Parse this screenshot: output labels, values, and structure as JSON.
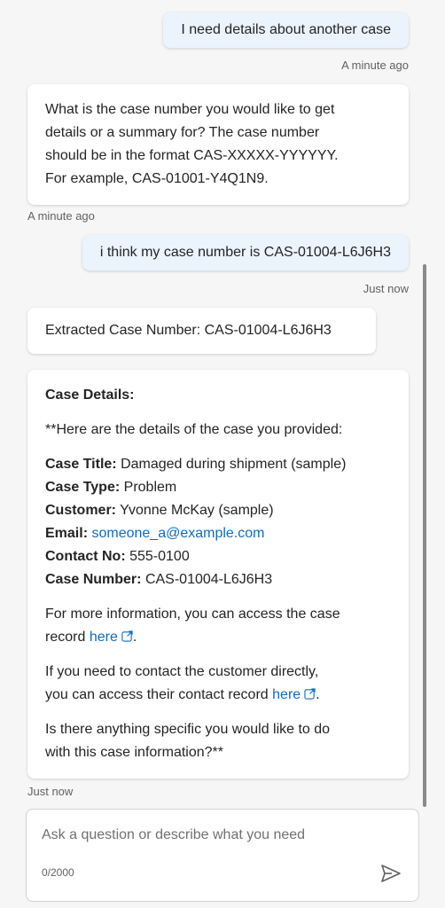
{
  "messages": [
    {
      "role": "user",
      "text": "I need details about another case",
      "time": "A minute ago"
    },
    {
      "role": "bot",
      "lines": [
        "What is the case number you would like to get",
        "details or a summary for? The case number",
        "should be in the format CAS-XXXXX-YYYYYY.",
        "For example, CAS-01001-Y4Q1N9."
      ],
      "time": "A minute ago"
    },
    {
      "role": "user",
      "text": "i think my case number is CAS-01004-L6J6H3",
      "time": "Just now"
    },
    {
      "role": "bot",
      "text": "Extracted Case Number: CAS-01004-L6J6H3"
    }
  ],
  "details": {
    "heading": "Case Details:",
    "intro": "**Here are the details of the case you provided:",
    "fields": {
      "title_label": "Case Title:",
      "title_value": "Damaged during shipment (sample)",
      "type_label": "Case Type:",
      "type_value": "Problem",
      "customer_label": "Customer:",
      "customer_value": "Yvonne McKay (sample)",
      "email_label": "Email:",
      "email_value": "someone_a@example.com",
      "contact_label": "Contact No:",
      "contact_value": "555-0100",
      "number_label": "Case Number:",
      "number_value": "CAS-01004-L6J6H3"
    },
    "more_info_line1": "For more information, you can access the case",
    "more_info_line2": "record",
    "more_info_link": "here",
    "contact_line1": "If you need to contact the customer directly,",
    "contact_line2": "you can access their contact record",
    "contact_link": "here",
    "closing_line1": "Is there anything specific you would like to do",
    "closing_line2": "with this case information?**",
    "time": "Just now"
  },
  "composer": {
    "placeholder": "Ask a question or describe what you need",
    "counter": "0/2000"
  },
  "icons": {
    "send": "send-icon",
    "external": "open-external-icon"
  },
  "colors": {
    "link": "#0f6cbd",
    "user_bubble": "#ebf3fc",
    "background": "#f6f6f7"
  }
}
